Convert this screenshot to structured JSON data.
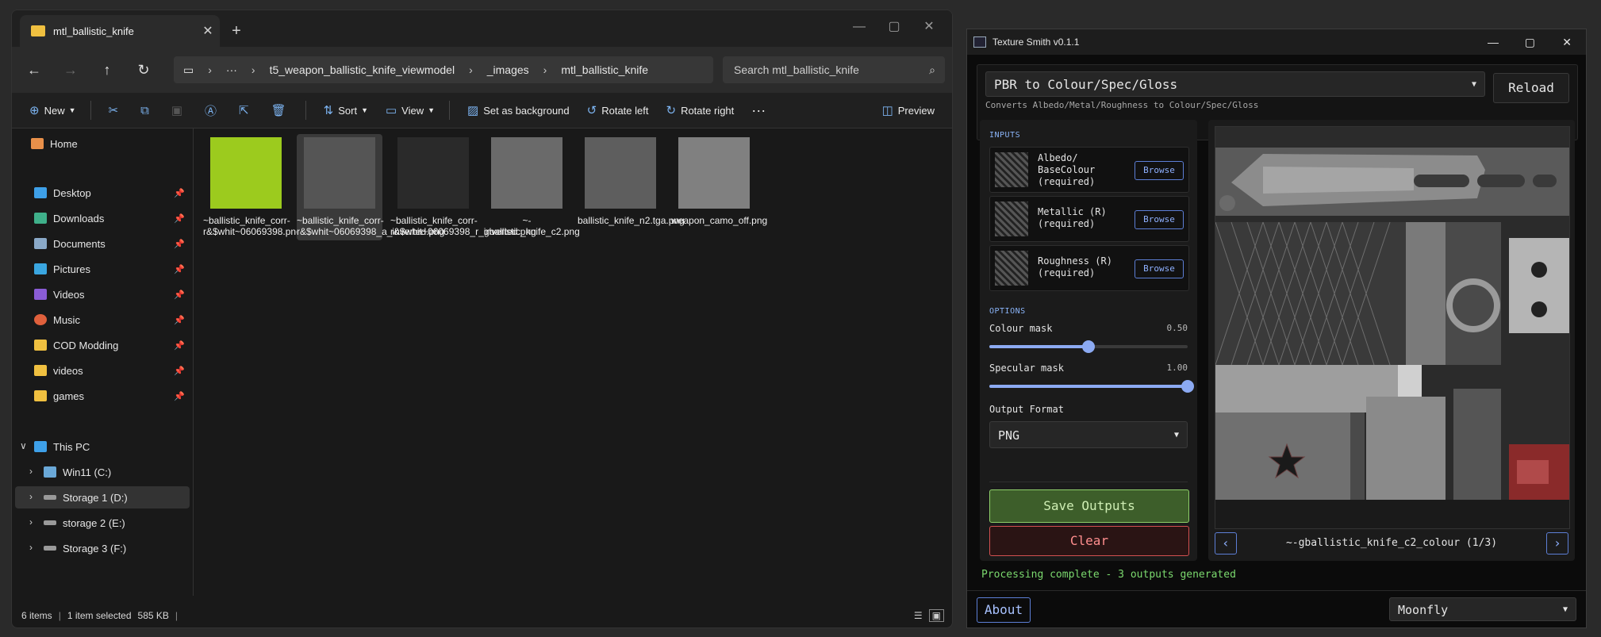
{
  "explorer": {
    "tab_title": "mtl_ballistic_knife",
    "tab_close": "✕",
    "new_tab": "+",
    "window_min": "—",
    "window_max": "▢",
    "window_close": "✕",
    "nav": {
      "back": "←",
      "forward": "→",
      "up": "↑",
      "refresh": "↻"
    },
    "breadcrumb": [
      "t5_weapon_ballistic_knife_viewmodel",
      "_images",
      "mtl_ballistic_knife"
    ],
    "breadcrumb_more": "···",
    "breadcrumb_sep": "›",
    "search_placeholder": "Search mtl_ballistic_knife",
    "commands": {
      "new": "New",
      "sort": "Sort",
      "view": "View",
      "set_background": "Set as background",
      "rotate_left": "Rotate left",
      "rotate_right": "Rotate right",
      "more": "···",
      "preview": "Preview"
    },
    "sidebar": {
      "home": "Home",
      "pinned": [
        "Desktop",
        "Downloads",
        "Documents",
        "Pictures",
        "Videos",
        "Music",
        "COD Modding",
        "videos",
        "games"
      ],
      "this_pc": "This PC",
      "drives": [
        "Win11 (C:)",
        "Storage 1 (D:)",
        "storage 2 (E:)",
        "Storage 3 (F:)"
      ]
    },
    "files": [
      {
        "name": "~ballistic_knife_corr-r&$whit~06069398.png",
        "thumb": "#9ccb1e"
      },
      {
        "name": "~ballistic_knife_corr-r&$whit~06069398_a_inverted.png",
        "thumb": "#555555"
      },
      {
        "name": "~ballistic_knife_corr-r&$whit~06069398_r_inverted.png",
        "thumb": "#2a2a2a"
      },
      {
        "name": "~-gballistic_knife_c2.png",
        "thumb": "#6a6a6a"
      },
      {
        "name": "ballistic_knife_n2.tga.png",
        "thumb": "#5e5e5e"
      },
      {
        "name": "weapon_camo_off.png",
        "thumb": "#808080"
      }
    ],
    "status": {
      "items": "6 items",
      "selected": "1 item selected",
      "size": "585 KB"
    }
  },
  "ts": {
    "title": "Texture Smith v0.1.1",
    "win_min": "—",
    "win_max": "▢",
    "win_close": "✕",
    "mode": "PBR to Colour/Spec/Gloss",
    "mode_desc": "Converts Albedo/Metal/Roughness to Colour/Spec/Gloss",
    "reload": "Reload",
    "inputs_label": "INPUTS",
    "inputs": [
      {
        "label": "Albedo/ BaseColour (required)",
        "button": "Browse"
      },
      {
        "label": "Metallic (R) (required)",
        "button": "Browse"
      },
      {
        "label": "Roughness (R) (required)",
        "button": "Browse"
      }
    ],
    "options_label": "OPTIONS",
    "colour_mask": {
      "label": "Colour mask",
      "value": "0.50",
      "level": 0.5
    },
    "specular_mask": {
      "label": "Specular mask",
      "value": "1.00",
      "level": 1.0
    },
    "output_format_label": "Output Format",
    "output_format": "PNG",
    "save": "Save Outputs",
    "clear": "Clear",
    "preview_caption": "~-gballistic_knife_c2_colour (1/3)",
    "prev": "‹",
    "next": "›",
    "status": "Processing complete - 3 outputs generated",
    "about": "About",
    "theme": "Moonfly",
    "arrow": "▼"
  }
}
